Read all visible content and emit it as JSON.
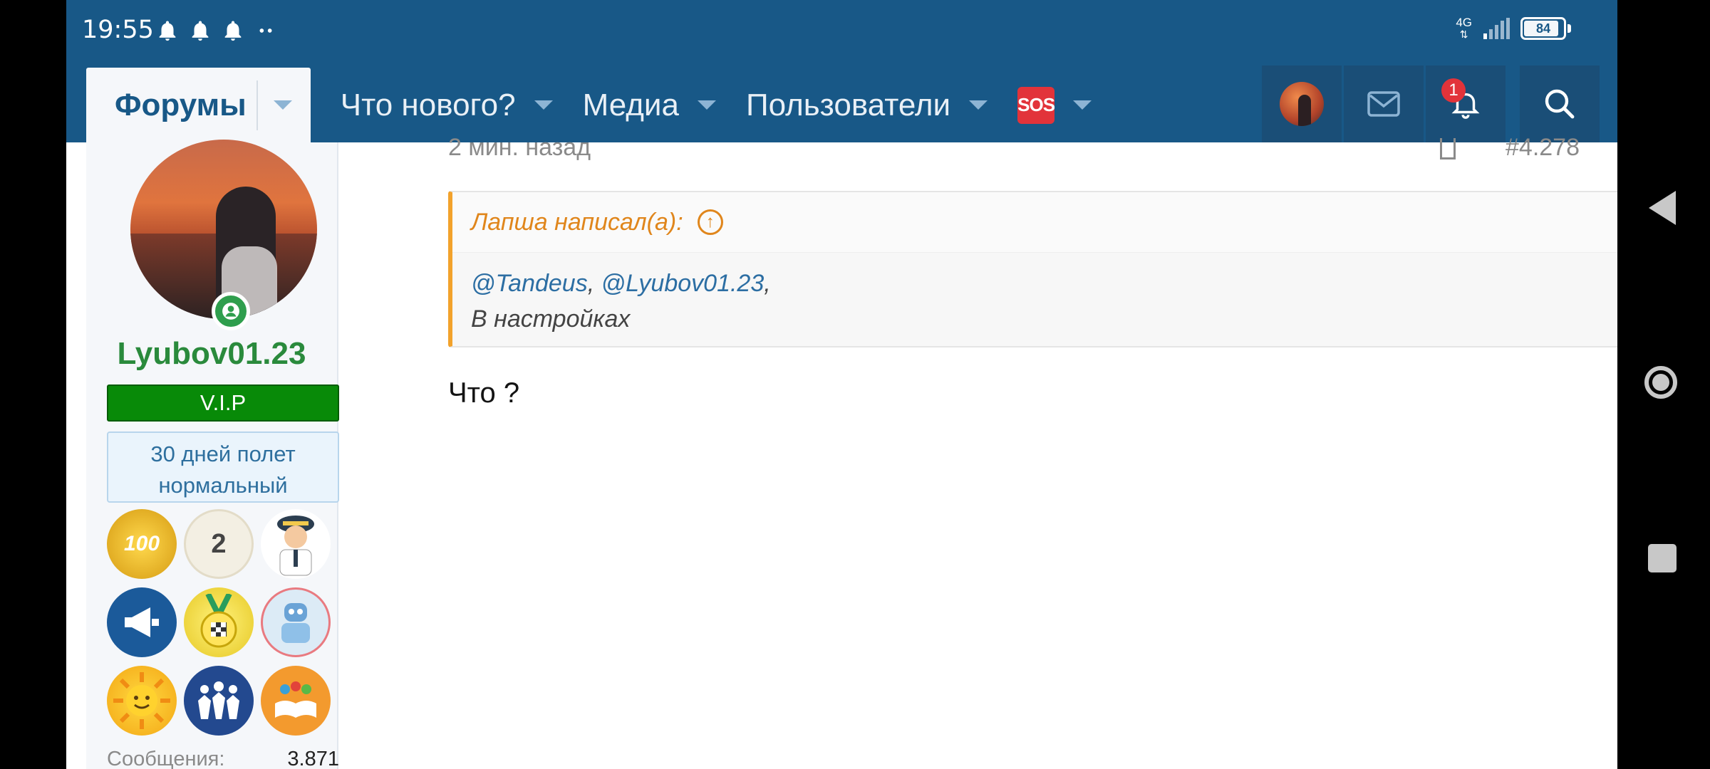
{
  "status_bar": {
    "time": "19:55",
    "network": "4G",
    "battery": "84"
  },
  "nav": {
    "tabs": [
      {
        "label": "Форумы"
      },
      {
        "label": "Что нового?"
      },
      {
        "label": "Медиа"
      },
      {
        "label": "Пользователи"
      },
      {
        "label": "SOS"
      }
    ],
    "notifications_count": "1"
  },
  "author": {
    "username": "Lyubov01.23",
    "rank": "V.I.P",
    "status_line1": "30 дней полет",
    "status_line2": "нормальный",
    "trophies": [
      "100",
      "2",
      "",
      "",
      "",
      "",
      "",
      "",
      ""
    ],
    "stats": [
      {
        "label": "Сообщения:",
        "value": "3.871"
      }
    ]
  },
  "post": {
    "time": "2 мин. назад",
    "number": "#4.278",
    "quote": {
      "author_line": "Лапша написал(а):",
      "mention1": "@Tandeus",
      "mention2": "@Lyubov01.23",
      "text": "В настройках"
    },
    "message": "Что ?"
  },
  "colors": {
    "navbar": "#185887",
    "accent_orange": "#f2a22c",
    "vip_green": "#088a08",
    "username_green": "#2a8a3c"
  }
}
